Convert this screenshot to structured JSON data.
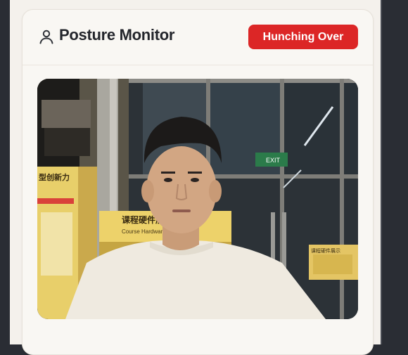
{
  "header": {
    "title": "Posture Monitor",
    "user_icon": "user-icon",
    "status": {
      "label": "Hunching Over",
      "color": "#dc2626"
    }
  },
  "video": {
    "signs": {
      "exit": "EXIT",
      "banner": "课程硬件展",
      "banner_sub": "Course Hardware Exhibition",
      "poster_left": "型创新力",
      "poster_right": "课程硬件展示"
    }
  },
  "colors": {
    "background": "#2a2d34",
    "card": "#f9f7f3",
    "alert": "#dc2626"
  }
}
